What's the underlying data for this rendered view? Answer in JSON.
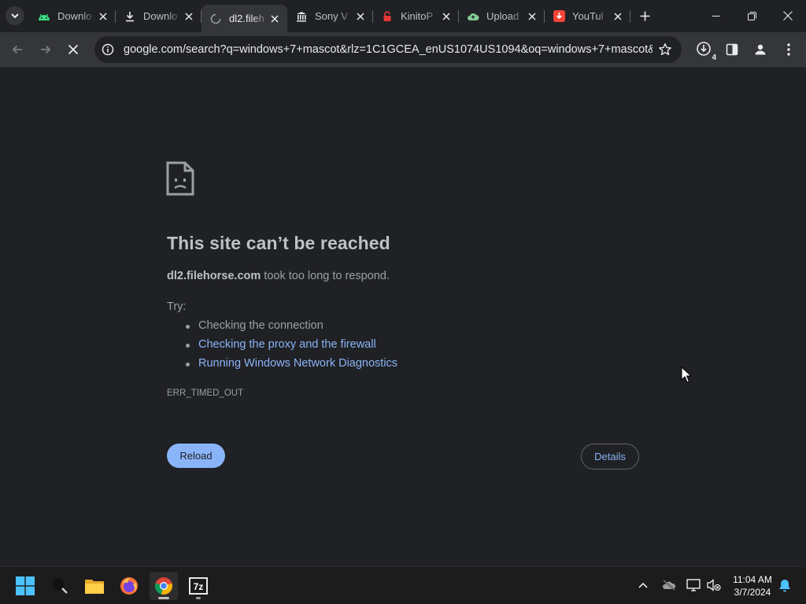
{
  "tabs": [
    {
      "title": "Downlo",
      "icon": "android-icon",
      "active": false
    },
    {
      "title": "Downlo",
      "icon": "download-icon",
      "active": false
    },
    {
      "title": "dl2.fileh",
      "icon": "loading-spinner-icon",
      "active": true
    },
    {
      "title": "Sony V",
      "icon": "bank-icon",
      "active": false
    },
    {
      "title": "KinitoP",
      "icon": "lock-icon",
      "active": false
    },
    {
      "title": "Upload",
      "icon": "cloud-icon",
      "active": false
    },
    {
      "title": "YouTul",
      "icon": "youtube-downloader-icon",
      "active": false
    }
  ],
  "toolbar": {
    "url": "google.com/search?q=windows+7+mascot&rlz=1C1GCEA_enUS1074US1094&oq=windows+7+mascot&g...",
    "downloads_count": "4"
  },
  "error": {
    "title": "This site can’t be reached",
    "host": "dl2.filehorse.com",
    "message": " took too long to respond.",
    "try_label": "Try:",
    "suggestions": [
      "Checking the connection",
      "Checking the proxy and the firewall",
      "Running Windows Network Diagnostics"
    ],
    "code": "ERR_TIMED_OUT",
    "reload_label": "Reload",
    "details_label": "Details"
  },
  "taskbar": {
    "time": "11:04 AM",
    "date": "3/7/2024",
    "apps": [
      "start-icon",
      "search-icon",
      "file-explorer-icon",
      "firefox-icon",
      "chrome-icon",
      "7zip-icon"
    ]
  },
  "colors": {
    "background": "#202124",
    "toolbar": "#35363a",
    "link": "#8ab4f8",
    "text": "#bdc1c6"
  }
}
